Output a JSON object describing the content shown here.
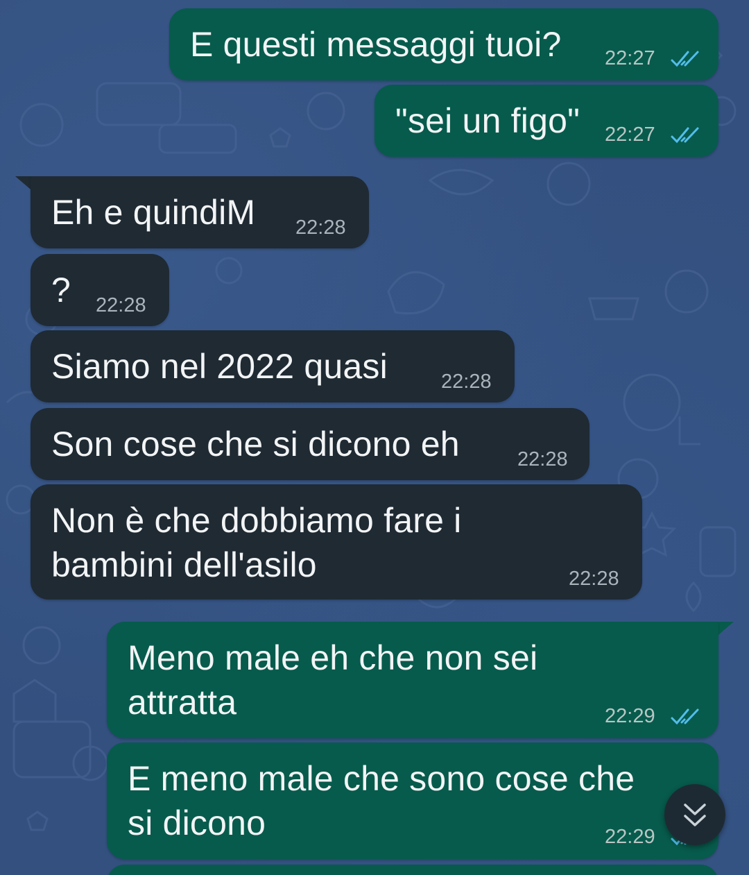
{
  "colors": {
    "outgoing_bubble": "#075b4c",
    "incoming_bubble": "#1f2a33",
    "read_ticks": "#53bdeb",
    "wallpaper": "#33507f"
  },
  "messages": [
    {
      "direction": "outgoing",
      "text": "E questi messaggi tuoi?",
      "time": "22:27",
      "status": "read-ticks-icon"
    },
    {
      "direction": "outgoing",
      "text": "\"sei un figo\"",
      "time": "22:27",
      "status": "read-ticks-icon"
    },
    {
      "direction": "incoming",
      "text": "Eh e quindiM",
      "time": "22:28"
    },
    {
      "direction": "incoming",
      "text": "?",
      "time": "22:28"
    },
    {
      "direction": "incoming",
      "text": "Siamo nel 2022 quasi",
      "time": "22:28"
    },
    {
      "direction": "incoming",
      "text": "Son cose che si dicono eh",
      "time": "22:28"
    },
    {
      "direction": "incoming",
      "text": "Non è che dobbiamo fare i\nbambini dell'asilo",
      "time": "22:28"
    },
    {
      "direction": "outgoing",
      "text": "Meno male eh che non sei\nattratta",
      "time": "22:29",
      "status": "read-ticks-icon"
    },
    {
      "direction": "outgoing",
      "text": "E meno male che sono cose che\nsi dicono",
      "time": "22:29",
      "status": "read-ticks-icon"
    }
  ],
  "scroll_to_bottom": {
    "icon": "double-chevron-down-icon"
  }
}
